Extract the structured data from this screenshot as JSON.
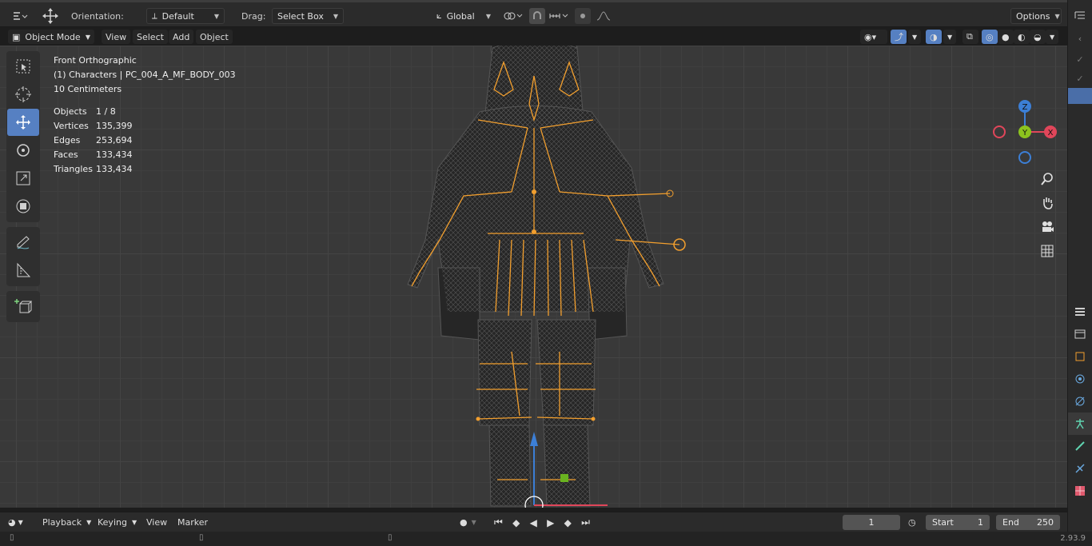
{
  "tool_header": {
    "orientation_label": "Orientation:",
    "orientation_value": "Default",
    "drag_label": "Drag:",
    "drag_value": "Select Box",
    "transform_space": "Global",
    "options_label": "Options"
  },
  "viewport_header": {
    "mode": "Object Mode",
    "menus": [
      "View",
      "Select",
      "Add",
      "Object"
    ]
  },
  "overlay": {
    "view_name": "Front Orthographic",
    "collection_object": "(1) Characters | PC_004_A_MF_BODY_003",
    "scale": "10 Centimeters",
    "stats": [
      {
        "label": "Objects",
        "value": "1 / 8"
      },
      {
        "label": "Vertices",
        "value": "135,399"
      },
      {
        "label": "Edges",
        "value": "253,694"
      },
      {
        "label": "Faces",
        "value": "133,434"
      },
      {
        "label": "Triangles",
        "value": "133,434"
      }
    ]
  },
  "gizmo": {
    "z": "Z",
    "y": "Y",
    "x": "X"
  },
  "toolbar_tools": [
    "select-box-icon",
    "cursor-icon",
    "move-icon",
    "rotate-icon",
    "scale-icon",
    "transform-icon",
    "annotate-icon",
    "measure-icon",
    "add-cube-icon"
  ],
  "timeline": {
    "menus": [
      "Playback",
      "Keying",
      "View",
      "Marker"
    ],
    "current_frame": "1",
    "start_label": "Start",
    "start_value": "1",
    "end_label": "End",
    "end_value": "250"
  },
  "status": {
    "version": "2.93.9"
  },
  "colors": {
    "accent": "#5680c2",
    "armature": "#f29f2e",
    "axis_x": "#e0465a",
    "axis_y": "#8cc31e",
    "axis_z": "#3c7fd6"
  }
}
